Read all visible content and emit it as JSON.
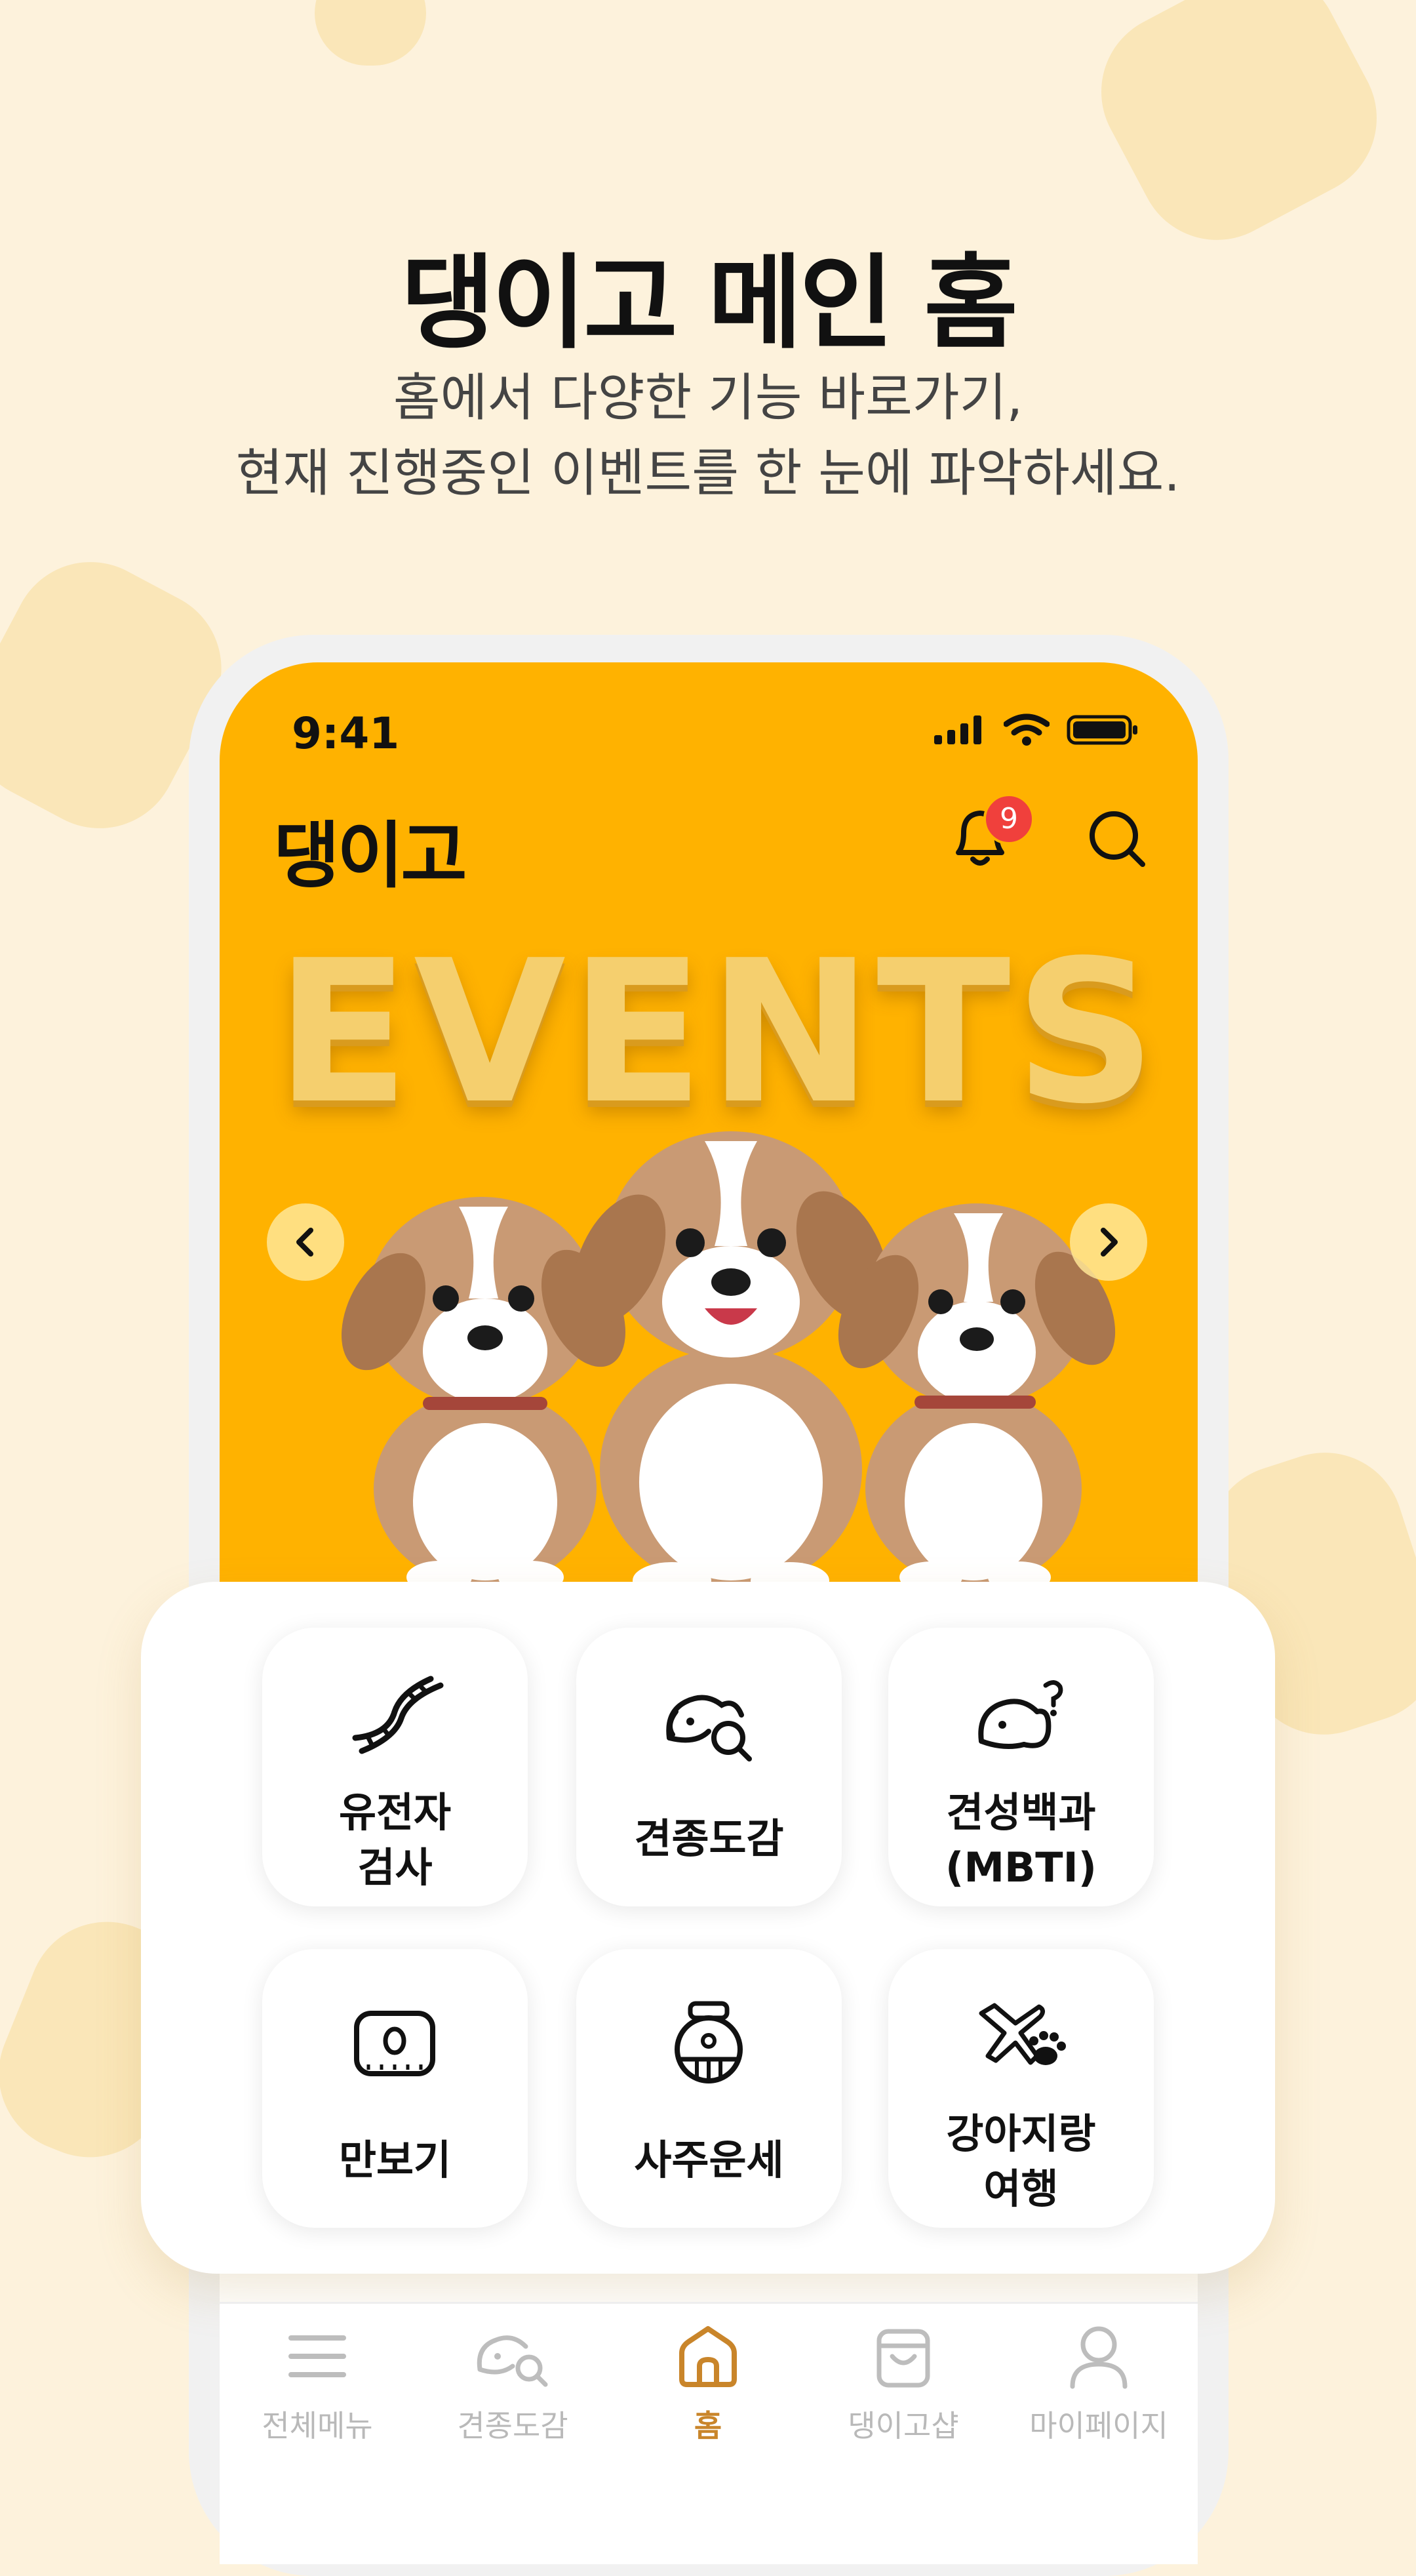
{
  "promo": {
    "headline": "댕이고 메인 홈",
    "subtitle_line1": "홈에서 다양한 기능 바로가기,",
    "subtitle_line2": "현재 진행중인 이벤트를 한 눈에 파악하세요."
  },
  "status_bar": {
    "time": "9:41"
  },
  "header": {
    "logo": "댕이고",
    "notification_count": "9"
  },
  "banner": {
    "title": "EVENTS"
  },
  "menu": {
    "items": [
      {
        "label": "유전자\n검사",
        "icon": "dna-icon"
      },
      {
        "label": "견종도감",
        "icon": "dog-search-icon"
      },
      {
        "label": "견성백과\n(MBTI)",
        "icon": "dog-question-icon"
      },
      {
        "label": "만보기",
        "icon": "pedometer-icon"
      },
      {
        "label": "사주운세",
        "icon": "fortune-pot-icon"
      },
      {
        "label": "강아지랑\n여행",
        "icon": "plane-paw-icon"
      }
    ]
  },
  "tabbar": {
    "items": [
      {
        "label": "전체메뉴",
        "icon": "hamburger-menu-icon"
      },
      {
        "label": "견종도감",
        "icon": "dog-search-icon"
      },
      {
        "label": "홈",
        "icon": "home-icon"
      },
      {
        "label": "댕이고샵",
        "icon": "shopping-bag-icon"
      },
      {
        "label": "마이페이지",
        "icon": "user-icon"
      }
    ],
    "active": "홈"
  },
  "colors": {
    "brand_yellow": "#ffb200",
    "active_tab": "#c9852a",
    "badge_red": "#f0403c"
  }
}
